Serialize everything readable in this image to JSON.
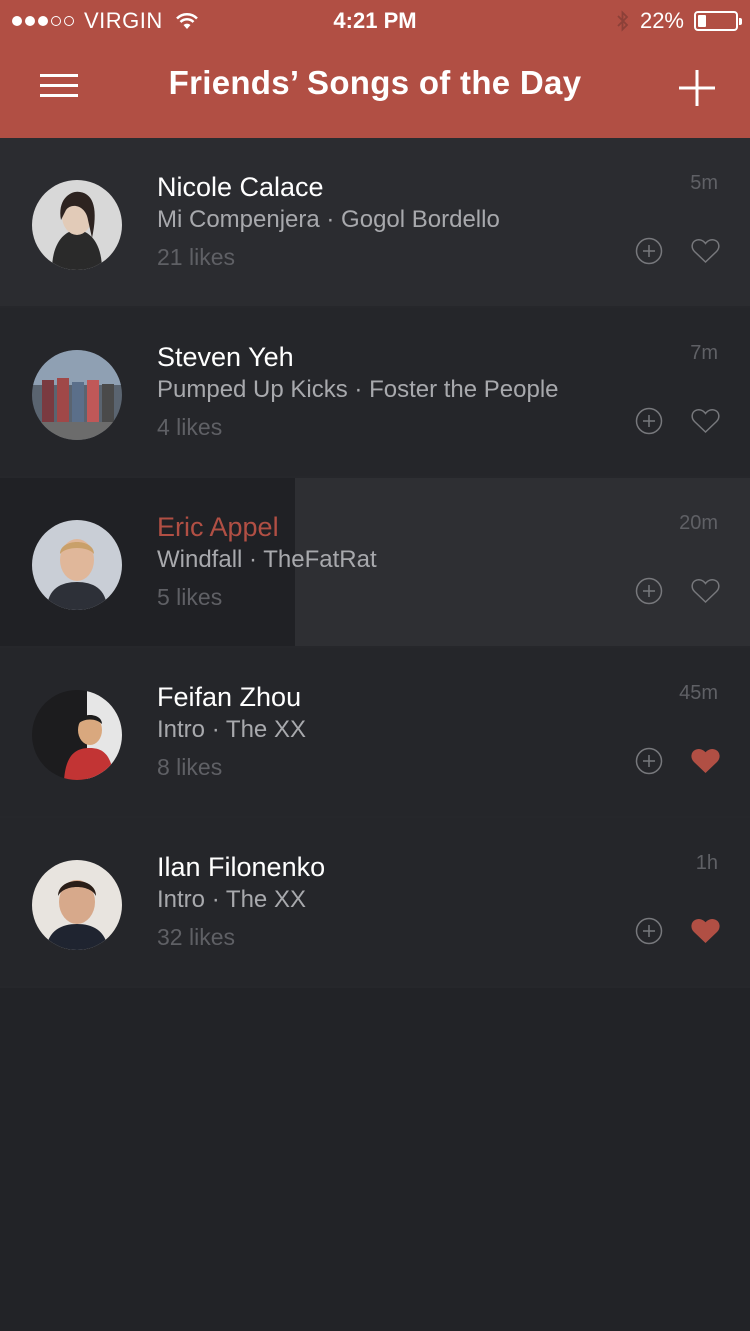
{
  "status_bar": {
    "carrier": "VIRGIN",
    "signal_filled": 3,
    "signal_total": 5,
    "time": "4:21 PM",
    "battery": "22%",
    "battery_level": 0.22
  },
  "nav": {
    "title": "Friends’ Songs of the Day",
    "menu_icon": "hamburger-menu-icon",
    "add_icon": "plus-icon"
  },
  "colors": {
    "accent": "#b14f44",
    "background": "#222327"
  },
  "feed": [
    {
      "name": "Nicole Calace",
      "song": "Mi Compenjera · Gogol Bordello",
      "likes": "21 likes",
      "time": "5m",
      "liked": false
    },
    {
      "name": "Steven Yeh",
      "song": "Pumped Up Kicks · Foster the People",
      "likes": "4 likes",
      "time": "7m",
      "liked": false
    },
    {
      "name": "Eric Appel",
      "song": "Windfall · TheFatRat",
      "likes": "5 likes",
      "time": "20m",
      "liked": false
    },
    {
      "name": "Feifan Zhou",
      "song": "Intro · The XX",
      "likes": "8 likes",
      "time": "45m",
      "liked": true
    },
    {
      "name": "Ilan Filonenko",
      "song": "Intro · The XX",
      "likes": "32 likes",
      "time": "1h",
      "liked": true
    }
  ]
}
